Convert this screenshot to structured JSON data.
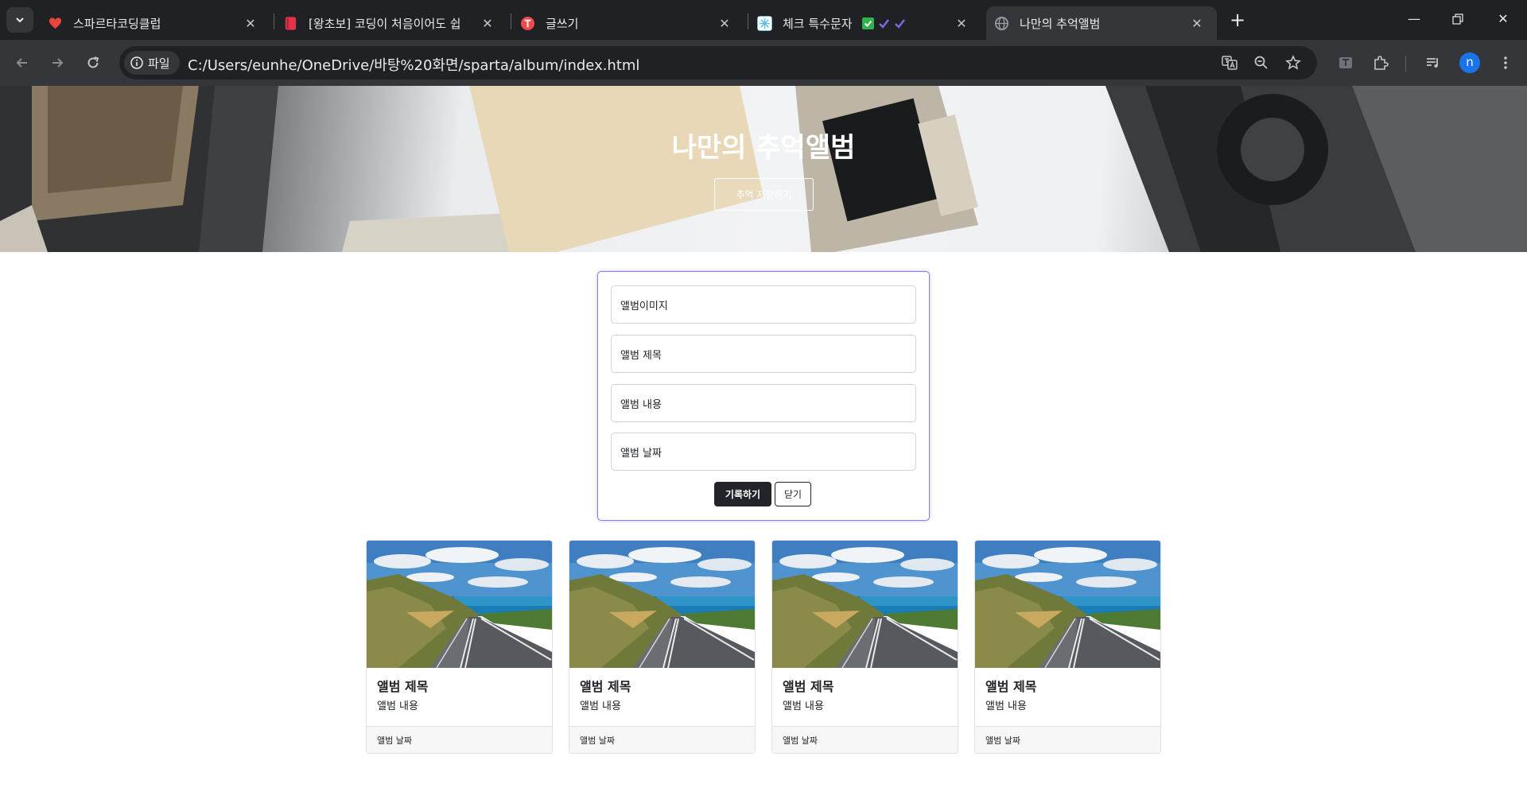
{
  "browser": {
    "tabs": [
      {
        "title": "스파르타코딩클럽",
        "favicon": "heart-icon",
        "color": "#e8453c"
      },
      {
        "title": "[왕초보] 코딩이 처음이어도 쉽",
        "favicon": "book-icon",
        "color": "#e0344a"
      },
      {
        "title": "글쓰기",
        "favicon": "pen-icon",
        "color": "#f04b4b"
      },
      {
        "title": "체크 특수문자",
        "favicon": "snowflake-icon",
        "color": "#5fc0e6"
      },
      {
        "title": "나만의 추억앨범",
        "favicon": "globe-icon",
        "color": "#9aa0a6"
      }
    ],
    "active_tab": 4,
    "tab_close": "✕",
    "address_chip": "파일",
    "url": "C:/Users/eunhe/OneDrive/바탕%20화면/sparta/album/index.html",
    "profile_initial": "n",
    "accent": "#1a73e8"
  },
  "hero": {
    "title": "나만의 추억앨범",
    "button": "추억 저장하기"
  },
  "form": {
    "fields": [
      {
        "label": "앨범이미지"
      },
      {
        "label": "앨범 제목"
      },
      {
        "label": "앨범 내용"
      },
      {
        "label": "앨범 날짜"
      }
    ],
    "save_label": "기록하기",
    "close_label": "닫기",
    "border_color": "#8a7cf5"
  },
  "cards": [
    {
      "title": "앨범 제목",
      "text": "앨범 내용",
      "date": "앨범 날짜"
    },
    {
      "title": "앨범 제목",
      "text": "앨범 내용",
      "date": "앨범 날짜"
    },
    {
      "title": "앨범 제목",
      "text": "앨범 내용",
      "date": "앨범 날짜"
    },
    {
      "title": "앨범 제목",
      "text": "앨범 내용",
      "date": "앨범 날짜"
    }
  ]
}
